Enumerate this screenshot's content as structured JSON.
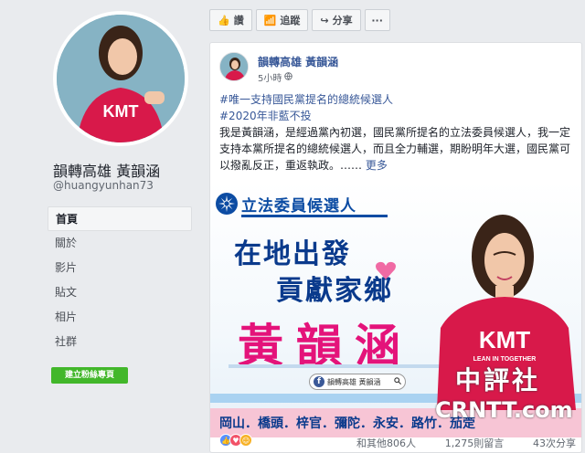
{
  "page": {
    "name": "韻轉高雄 黃韻涵",
    "handle": "@huangyunhan73"
  },
  "nav": [
    {
      "label": "首頁",
      "active": true
    },
    {
      "label": "關於",
      "active": false
    },
    {
      "label": "影片",
      "active": false
    },
    {
      "label": "貼文",
      "active": false
    },
    {
      "label": "相片",
      "active": false
    },
    {
      "label": "社群",
      "active": false
    }
  ],
  "create_page_button": "建立粉絲專頁",
  "actions": {
    "like": "讚",
    "follow": "追蹤",
    "share": "分享",
    "more": "···"
  },
  "post": {
    "author": "韻轉高雄 黃韻涵",
    "time": "5小時",
    "hashtag1": "#唯一支持國民黨提名的總統候選人",
    "hashtag2": "#2020年非藍不投",
    "body": "我是黃韻涵，是經過黨內初選，國民黨所提名的立法委員候選人，我一定支持本黨所提名的總統候選人，而且全力輔選，期盼明年大選，國民黨可以撥亂反正，重返執政。……",
    "more": "更多"
  },
  "campaign": {
    "candidate_label": "立法委員候選人",
    "slogan_line1": "在地出發",
    "slogan_line2": "貢獻家鄉",
    "name": "黃韻涵",
    "fb_search_text": "韻轉高雄 黃韻涵",
    "districts": "岡山．橋頭．梓官．彌陀．永安．路竹．茄萣",
    "shirt_text": "KMT",
    "shirt_subtext": "LEAN IN TOGETHER",
    "watermark_cn": "中評社",
    "watermark_en": "CRNTT.com"
  },
  "stats": {
    "reactions_text": "和其他806人",
    "comments": "1,275則留言",
    "shares": "43次分享"
  },
  "colors": {
    "fb_blue": "#385898",
    "kmt_blue": "#0c4ca3",
    "name_pink": "#e4137a",
    "shirt_red": "#d8194a",
    "create_green": "#42b72a"
  }
}
